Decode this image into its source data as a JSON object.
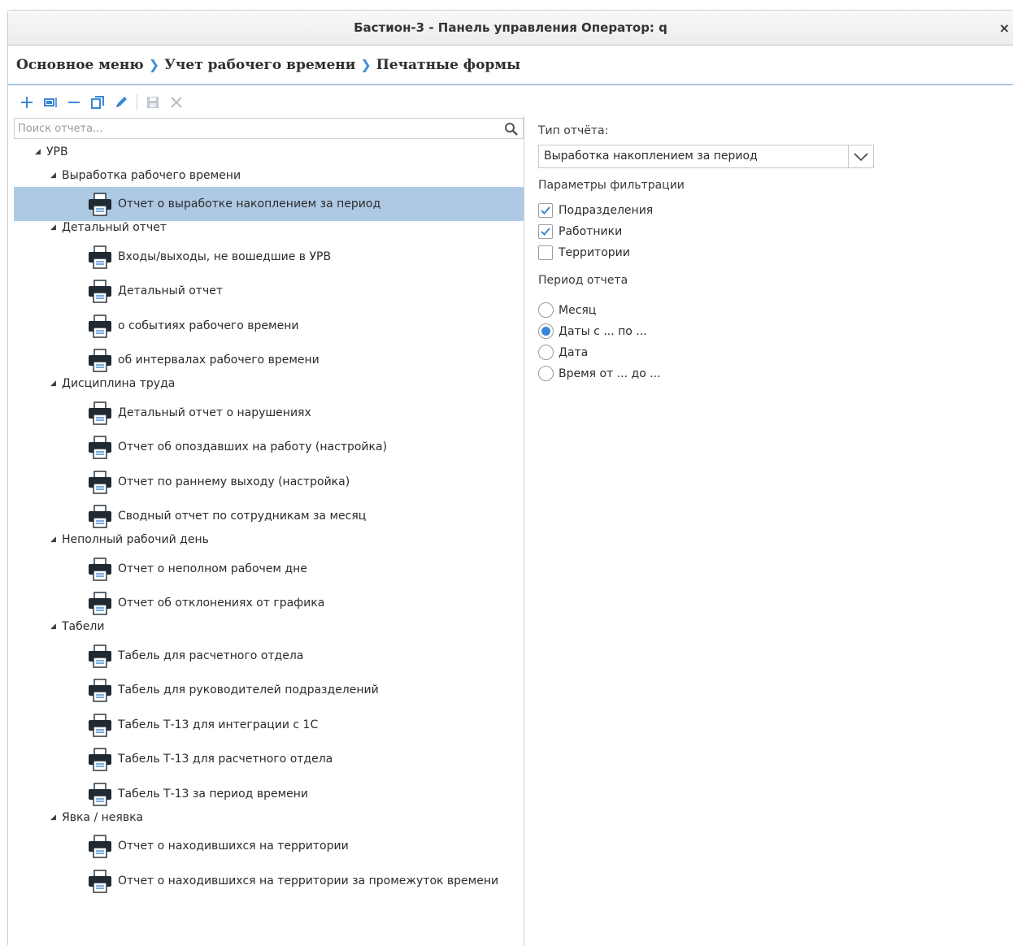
{
  "window": {
    "title": "Бастион-3 - Панель управления Оператор: q",
    "close_glyph": "×"
  },
  "breadcrumb": [
    "Основное меню",
    "Учет рабочего времени",
    "Печатные формы"
  ],
  "toolbar": {
    "buttons": [
      "add-icon",
      "edit-form-icon",
      "remove-icon",
      "copy-icon",
      "pencil-icon",
      "save-icon",
      "delete-icon"
    ],
    "accent_color": "#3b86d8"
  },
  "search": {
    "placeholder": "Поиск отчета...",
    "value": ""
  },
  "tree": {
    "root": "УРВ",
    "groups": [
      {
        "label": "Выработка рабочего времени",
        "items": [
          "Отчет о выработке накоплением за период"
        ]
      },
      {
        "label": "Детальный отчет",
        "items": [
          "Входы/выходы, не вошедшие в УРВ",
          "Детальный отчет",
          "о событиях рабочего времени",
          "об интервалах рабочего времени"
        ]
      },
      {
        "label": "Дисциплина труда",
        "items": [
          "Детальный отчет о нарушениях",
          "Отчет об опоздавших на работу (настройка)",
          "Отчет по раннему выходу (настройка)",
          "Сводный отчет по сотрудникам за месяц"
        ]
      },
      {
        "label": "Неполный рабочий день",
        "items": [
          "Отчет о неполном рабочем дне",
          "Отчет об отклонениях от графика"
        ]
      },
      {
        "label": "Табели",
        "items": [
          "Табель для расчетного отдела",
          "Табель для руководителей подразделений",
          "Табель Т-13 для интеграции с 1С",
          "Табель Т-13 для расчетного отдела",
          "Табель Т-13 за период времени"
        ]
      },
      {
        "label": "Явка / неявка",
        "items": [
          "Отчет о находившихся на территории",
          "Отчет о находившихся на территории за промежуток времени"
        ]
      }
    ],
    "selected_color": "#adc9e3"
  },
  "settings": {
    "report_type_label": "Тип отчёта:",
    "report_type_value": "Выработка накоплением за период",
    "filter_label": "Параметры фильтрации",
    "filters": [
      {
        "label": "Подразделения",
        "checked": true
      },
      {
        "label": "Работники",
        "checked": true
      },
      {
        "label": "Территории",
        "checked": false
      }
    ],
    "period_label": "Период отчета",
    "periods": [
      {
        "label": "Месяц",
        "selected": false
      },
      {
        "label": "Даты с ... по ...",
        "selected": true
      },
      {
        "label": "Дата",
        "selected": false
      },
      {
        "label": "Время от ... до ...",
        "selected": false
      }
    ]
  }
}
